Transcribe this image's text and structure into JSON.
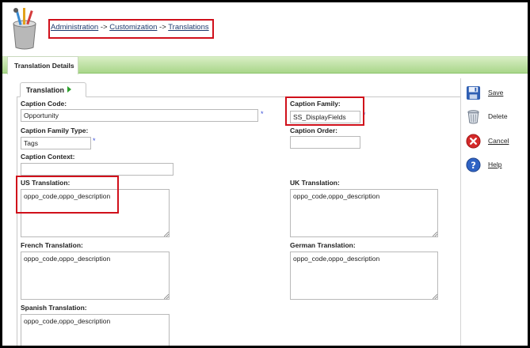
{
  "breadcrumb": {
    "item1": "Administration",
    "sep1": " -> ",
    "item2": "Customization",
    "sep2": " -> ",
    "item3": "Translations"
  },
  "tabs": {
    "active": "Translation Details"
  },
  "panel": {
    "tab_label": "Translation"
  },
  "form": {
    "caption_code": {
      "label": "Caption Code:",
      "value": "Opportunity",
      "required_mark": "*"
    },
    "caption_family": {
      "label": "Caption Family:",
      "value": "SS_DisplayFields",
      "required_mark": "*"
    },
    "caption_family_type": {
      "label": "Caption Family Type:",
      "value": "Tags",
      "required_mark": "*"
    },
    "caption_order": {
      "label": "Caption Order:",
      "value": ""
    },
    "caption_context": {
      "label": "Caption Context:",
      "value": ""
    },
    "us_translation": {
      "label": "US Translation:",
      "value": "oppo_code,oppo_description"
    },
    "uk_translation": {
      "label": "UK Translation:",
      "value": "oppo_code,oppo_description"
    },
    "french_translation": {
      "label": "French Translation:",
      "value": "oppo_code,oppo_description"
    },
    "german_translation": {
      "label": "German Translation:",
      "value": "oppo_code,oppo_description"
    },
    "spanish_translation": {
      "label": "Spanish Translation:",
      "value": "oppo_code,oppo_description"
    }
  },
  "actions": {
    "save": {
      "label": "Save",
      "icon": "save-disk-icon"
    },
    "delete": {
      "label": "Delete",
      "icon": "trash-can-icon"
    },
    "cancel": {
      "label": "Cancel",
      "icon": "cancel-x-icon"
    },
    "help": {
      "label": "Help",
      "icon": "help-question-icon"
    }
  },
  "colors": {
    "highlight": "#d0101b",
    "tabbar_green": "#a9d68a",
    "link": "#1d3a6e",
    "required": "#3b4fd8"
  }
}
